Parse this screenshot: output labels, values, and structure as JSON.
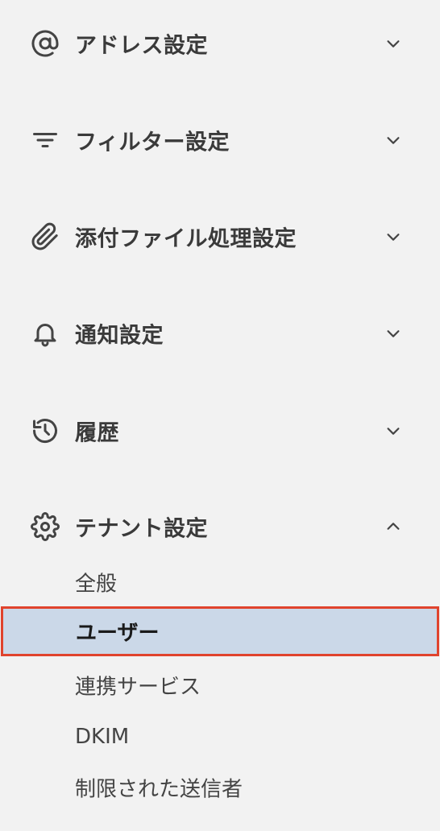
{
  "sections": [
    {
      "label": "アドレス設定",
      "icon": "at-icon",
      "expanded": false
    },
    {
      "label": "フィルター設定",
      "icon": "filter-icon",
      "expanded": false
    },
    {
      "label": "添付ファイル処理設定",
      "icon": "paperclip-icon",
      "expanded": false
    },
    {
      "label": "通知設定",
      "icon": "bell-icon",
      "expanded": false
    },
    {
      "label": "履歴",
      "icon": "history-icon",
      "expanded": false
    },
    {
      "label": "テナント設定",
      "icon": "gear-icon",
      "expanded": true
    }
  ],
  "tenant_items": [
    {
      "label": "全般",
      "active": false
    },
    {
      "label": "ユーザー",
      "active": true
    },
    {
      "label": "連携サービス",
      "active": false
    },
    {
      "label": "DKIM",
      "active": false
    },
    {
      "label": "制限された送信者",
      "active": false
    }
  ],
  "colors": {
    "background": "#f2f2f2",
    "active_background": "#cbd8e8",
    "active_border": "#e0432d",
    "text": "#3a3a3a"
  }
}
